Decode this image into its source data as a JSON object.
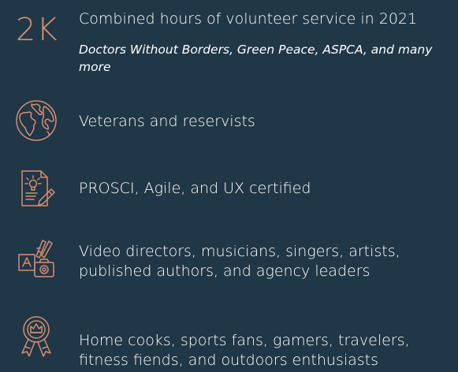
{
  "accent_color": "#d78d70",
  "background_color": "#203747",
  "stat": {
    "number": "2K",
    "text": "Combined hours of volunteer service in 2021",
    "subtext": "Doctors Without Borders, Green Peace, ASPCA, and many more"
  },
  "items": [
    {
      "icon": "globe-icon",
      "text": "Veterans and reservists"
    },
    {
      "icon": "certificate-icon",
      "text": "PROSCI, Agile, and UX certified"
    },
    {
      "icon": "creative-arts-icon",
      "text": "Video directors, musicians, singers, artists, published authors, and agency leaders"
    },
    {
      "icon": "award-ribbon-icon",
      "text": "Home cooks, sports fans, gamers, travelers, fitness fiends, and outdoors enthusiasts"
    }
  ]
}
